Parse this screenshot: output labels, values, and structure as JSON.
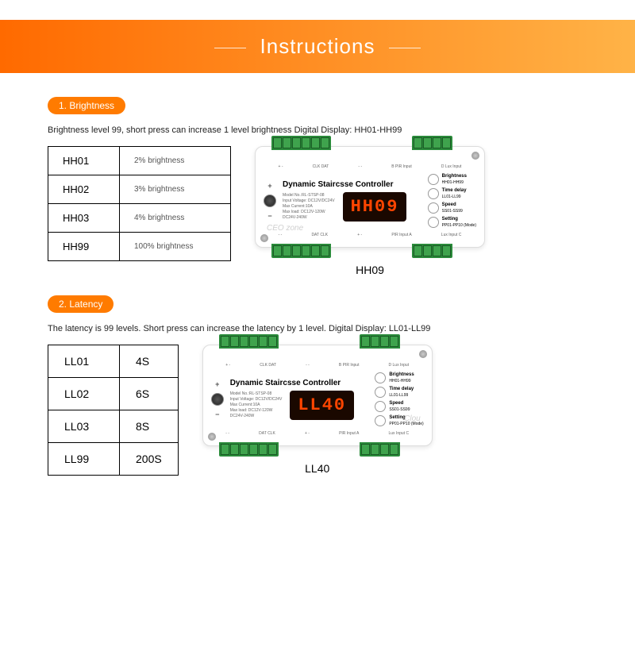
{
  "header": {
    "title": "Instructions"
  },
  "sections": {
    "brightness": {
      "pill": "1. Brightness",
      "desc": "Brightness level 99, short press can increase 1 level brightness Digital Display: HH01-HH99",
      "rows": [
        {
          "code": "HH01",
          "val": "2% brightness"
        },
        {
          "code": "HH02",
          "val": "3% brightness"
        },
        {
          "code": "HH03",
          "val": "4% brightness"
        },
        {
          "code": "HH99",
          "val": "100% brightness"
        }
      ],
      "device_display": "HH09",
      "caption": "HH09",
      "watermark": "CEO zone"
    },
    "latency": {
      "pill": "2. Latency",
      "desc": "The latency is 99 levels. Short press can increase the latency by 1 level. Digital Display: LL01-LL99",
      "rows": [
        {
          "code": "LL01",
          "val": "4S"
        },
        {
          "code": "LL02",
          "val": "6S"
        },
        {
          "code": "LL03",
          "val": "8S"
        },
        {
          "code": "LL99",
          "val": "200S"
        }
      ],
      "device_display": "LL40",
      "caption": "LL40",
      "watermark": "Clou"
    }
  },
  "device": {
    "title": "Dynamic Staircsse Controller",
    "specs": {
      "l1": "Model No.:RL-STSP-08",
      "l2": "Input Voltage:  DC12V/DC24V",
      "l3": "Max Current:10A",
      "l4": "Max load: DC12V-120W",
      "l5": "DC24V-240W"
    },
    "top_labels": {
      "a": "+ -",
      "b": "CLK  DAT",
      "c": "- -",
      "d": "B PIR Input",
      "e": "D Lux Input"
    },
    "bottom_labels": {
      "a": "- -",
      "b": "DAT  CLK",
      "c": "+ -",
      "d": "PIR Input A",
      "e": "Lux Input C"
    },
    "buttons": {
      "b1": {
        "main": "Brightness",
        "sub": "HH01-HH99"
      },
      "b2": {
        "main": "Time delay",
        "sub": "LL01-LL99"
      },
      "b3": {
        "main": "Speed",
        "sub": "SS01-SS99"
      },
      "b4": {
        "main": "Setting",
        "sub": "PP01-PP10 (Mode)"
      }
    }
  }
}
